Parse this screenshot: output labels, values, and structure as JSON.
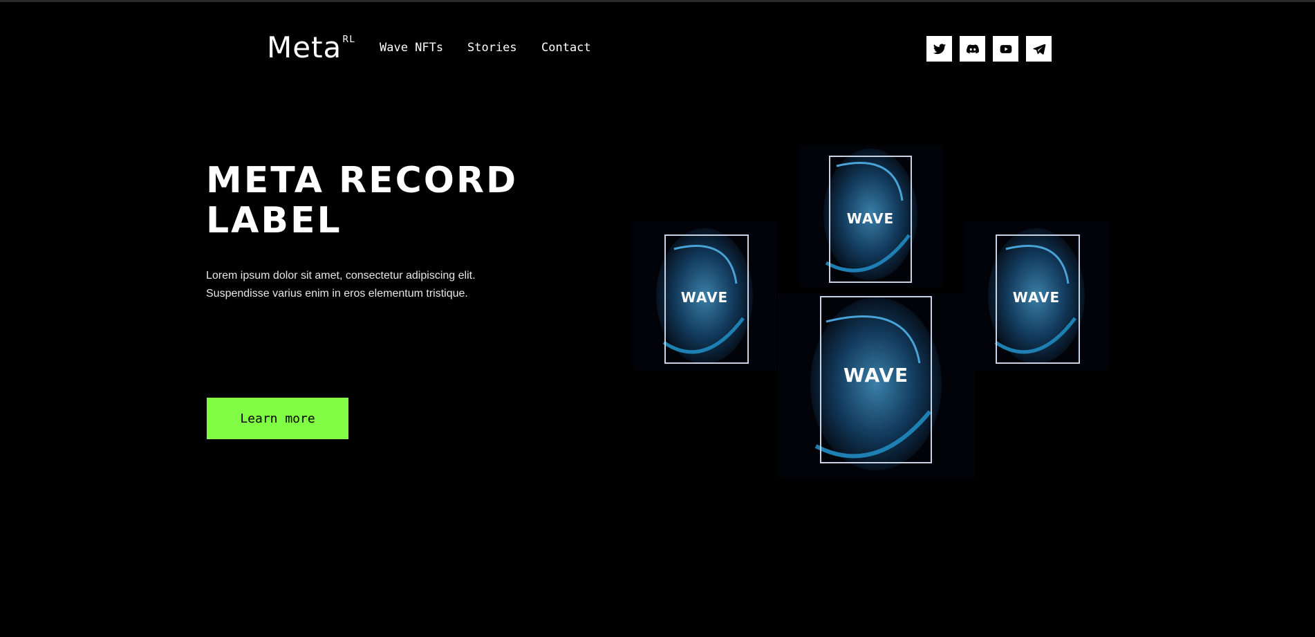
{
  "brand": {
    "name": "Meta",
    "sup": "RL"
  },
  "nav": {
    "items": [
      "Wave NFTs",
      "Stories",
      "Contact"
    ]
  },
  "social": [
    "twitter-icon",
    "discord-icon",
    "youtube-icon",
    "telegram-icon"
  ],
  "hero": {
    "title": "META RECORD LABEL",
    "description": "Lorem ipsum dolor sit amet, consectetur adipiscing elit. Suspendisse varius enim in eros elementum tristique.",
    "cta_label": "Learn more"
  },
  "cards": {
    "label": "WAVE"
  },
  "colors": {
    "background": "#000000",
    "accent": "#80fc44",
    "text": "#ffffff"
  }
}
